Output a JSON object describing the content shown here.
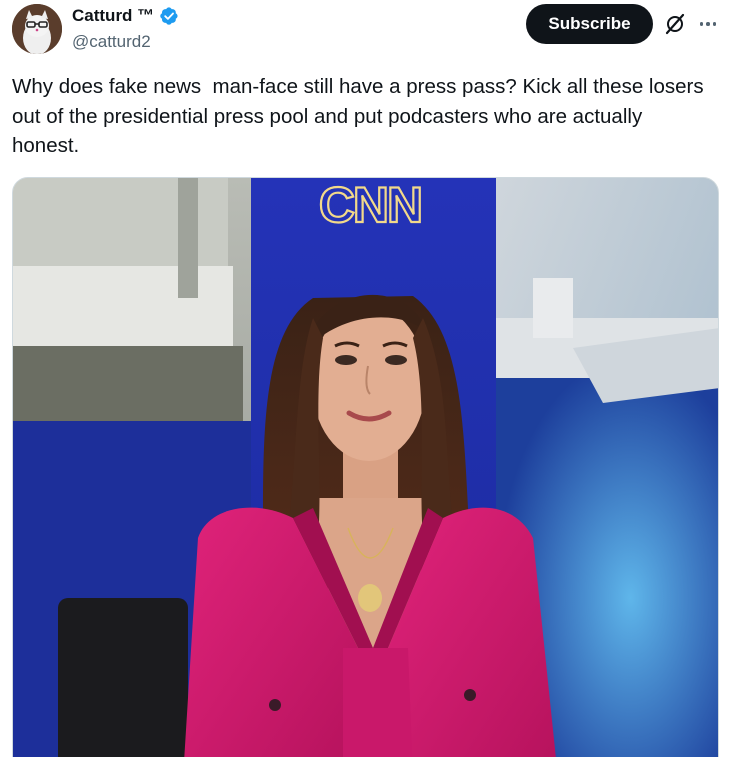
{
  "author": {
    "display_name": "Catturd ™",
    "handle": "@catturd2",
    "verified": true,
    "verified_color": "#1d9bf0"
  },
  "actions": {
    "subscribe_label": "Subscribe",
    "grok_icon": "grok-slash-icon",
    "more_icon": "more-horizontal-icon"
  },
  "tweet": {
    "text": "Why does fake news  man-face still have a press pass? Kick all these losers out of the presidential press pool and put podcasters who are actually honest."
  },
  "media": {
    "sign_text": "CNN",
    "accent_colors": {
      "studio_blue": "#1a2fb8",
      "blazer_pink": "#d0196d"
    }
  }
}
